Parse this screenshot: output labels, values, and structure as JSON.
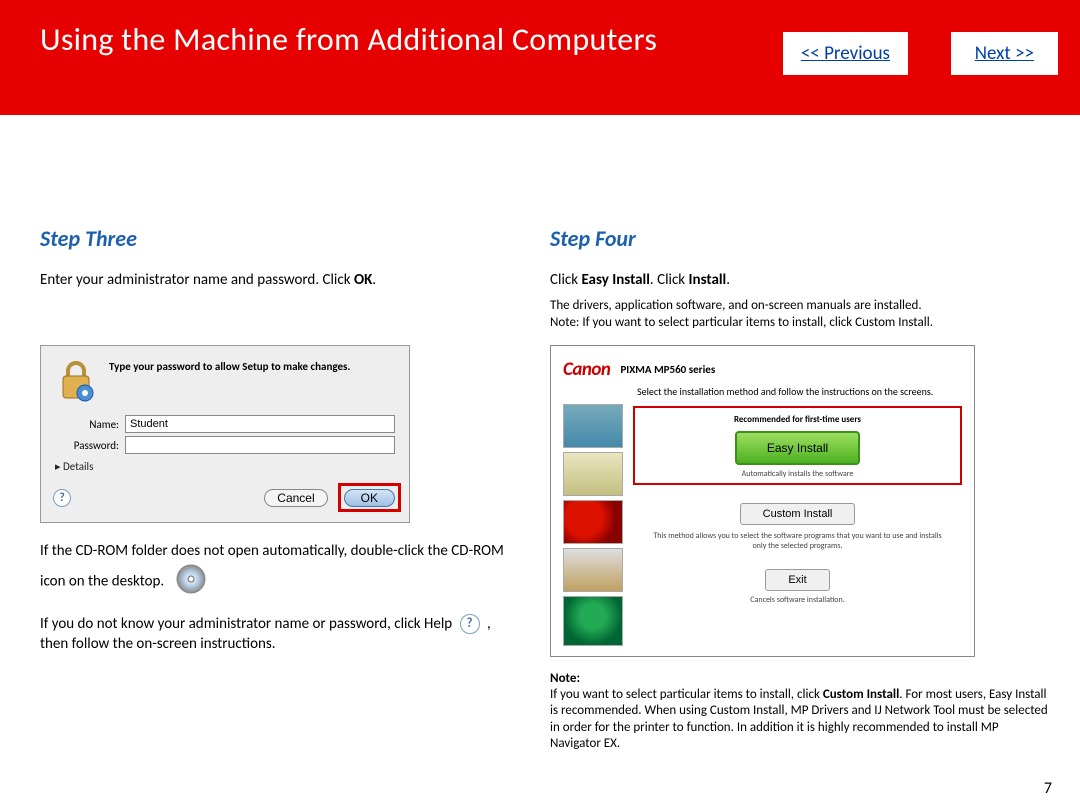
{
  "header": {
    "title": "Using the Machine from Additional Computers",
    "prev": "<< Previous",
    "next": "Next >>"
  },
  "step3": {
    "title": "Step Three",
    "intro_pre": "Enter your administrator name and password. Click ",
    "intro_bold": "OK",
    "intro_post": ".",
    "dialog": {
      "message": "Type your password to allow Setup to make changes.",
      "name_label": "Name:",
      "name_value": "Student",
      "password_label": "Password:",
      "details": "Details",
      "cancel": "Cancel",
      "ok": "OK"
    },
    "note_cd": "If the CD-ROM folder does not open automatically, double-click the CD-ROM icon on the desktop.",
    "help_pre": "If you do not know your administrator name or password, click Help ",
    "help_post": " , then follow the on-screen instructions."
  },
  "step4": {
    "title": "Step Four",
    "line1_pre": "Click ",
    "line1_b1": "Easy Install",
    "line1_mid": ". Click ",
    "line1_b2": "Install",
    "line1_post": ".",
    "line2": "The drivers, application software, and on-screen manuals are installed.",
    "line3": "Note: If you want to select particular items to install, click Custom Install.",
    "canon": {
      "logo": "Canon",
      "model": "PIXMA MP560 series",
      "subtitle": "Select the installation method and follow the instructions on the screens.",
      "recommended": "Recommended for first-time users",
      "easy": "Easy Install",
      "easy_note": "Automatically installs the software",
      "custom": "Custom Install",
      "custom_note": "This method allows you to select the software programs that you want to use and installs only the selected programs.",
      "exit": "Exit",
      "exit_note": "Cancels software installation."
    },
    "note_label": "Note:",
    "note_pre": "If you want to select particular items to install, click ",
    "note_bold": "Custom Install",
    "note_post": ". For most users, Easy Install is recommended.  When using Custom Install, MP Drivers and IJ Network Tool must be selected in order for the printer to function.  In addition it is highly recommended to install MP Navigator EX."
  },
  "page_number": "7"
}
